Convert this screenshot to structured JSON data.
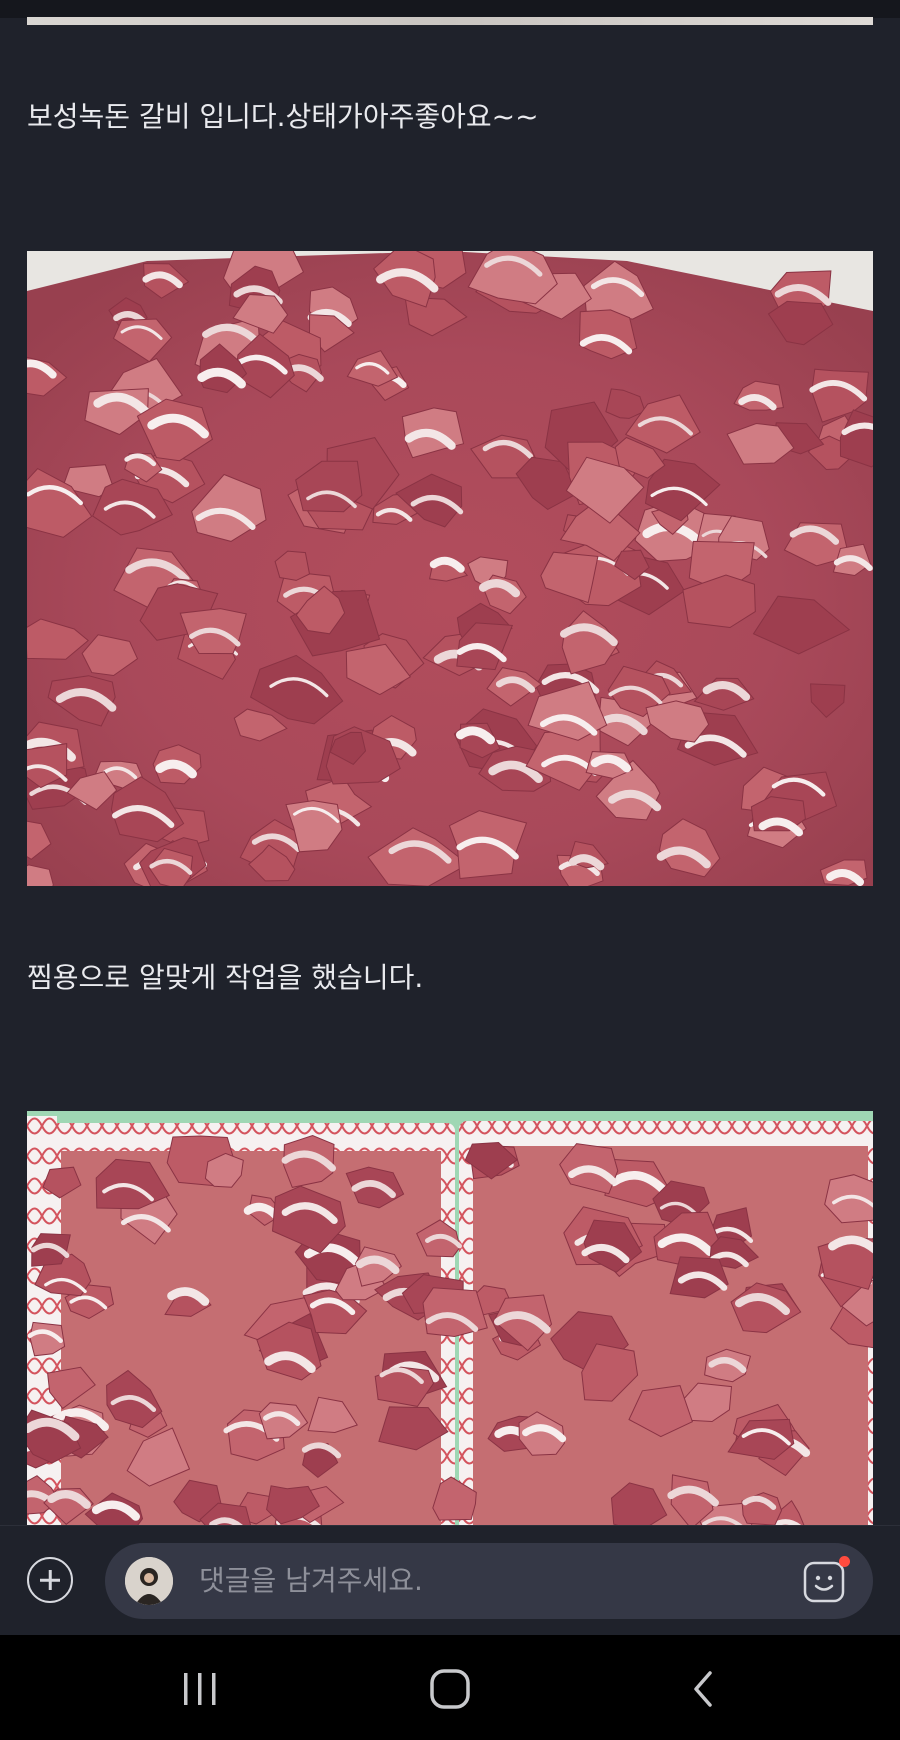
{
  "post": {
    "paragraph_1": "보성녹돈 갈비 입니다.상태가아주좋아요~~",
    "paragraph_2": "찜용으로 알맞게 작업을 했습니다."
  },
  "comment_bar": {
    "placeholder": "댓글을 남겨주세요.",
    "add_icon": "plus-circle-icon",
    "emoji_icon": "smiley-face-icon",
    "notification_dot_color": "#ff4b3e"
  },
  "nav_bar": {
    "recent_icon": "recent-apps-icon",
    "home_icon": "home-icon",
    "back_icon": "back-icon"
  },
  "colors": {
    "background": "#1f222b",
    "text": "#e9eaee",
    "input_bg": "#353846"
  }
}
